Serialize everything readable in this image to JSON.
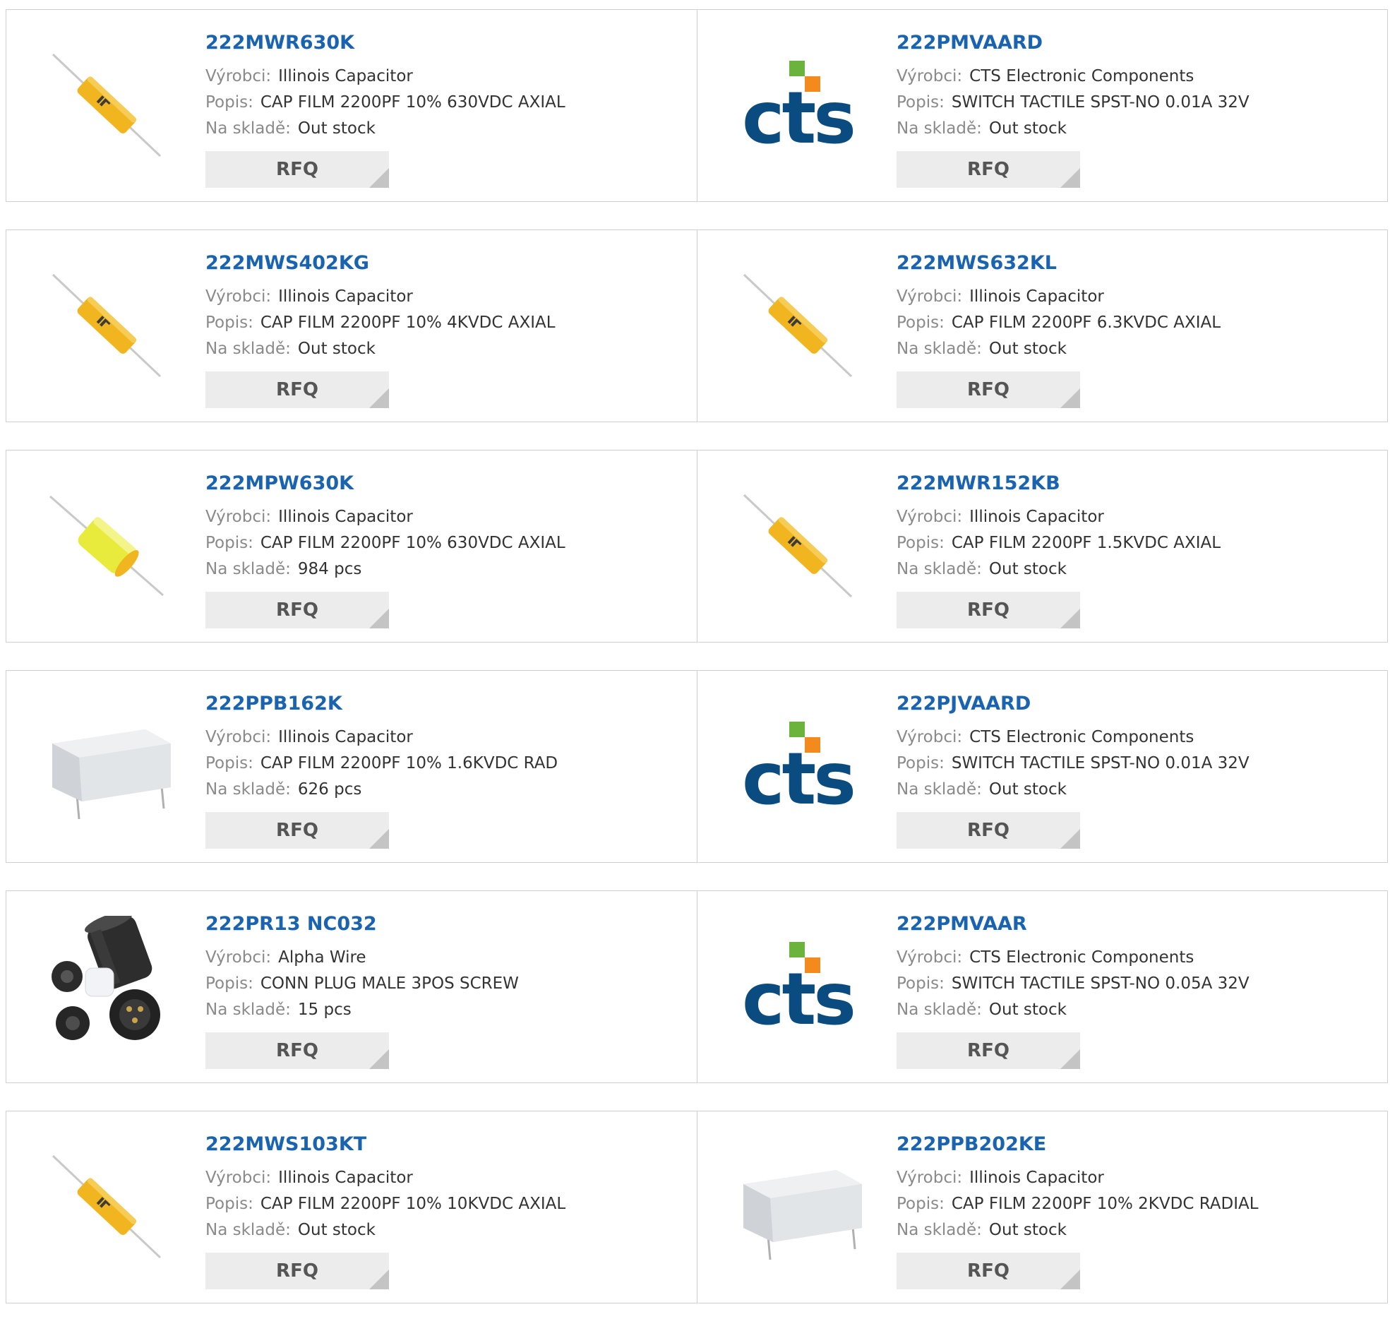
{
  "labels": {
    "manufacturer": "Výrobci:",
    "description": "Popis:",
    "stock": "Na skladě:",
    "rfq": "RFQ"
  },
  "colors": {
    "link": "#1a63b0",
    "label": "#8a8a8a",
    "value": "#333333",
    "rfq_bg": "#ececec",
    "border": "#cfcfcf"
  },
  "products": [
    {
      "part": "222MWR630K",
      "manufacturer": "Illinois Capacitor",
      "description": "CAP FILM 2200PF 10% 630VDC AXIAL",
      "stock": "Out stock",
      "image": "axial-capacitor-orange"
    },
    {
      "part": "222PMVAARD",
      "manufacturer": "CTS Electronic Components",
      "description": "SWITCH TACTILE SPST-NO 0.01A 32V",
      "stock": "Out stock",
      "image": "cts-logo"
    },
    {
      "part": "222MWS402KG",
      "manufacturer": "Illinois Capacitor",
      "description": "CAP FILM 2200PF 10% 4KVDC AXIAL",
      "stock": "Out stock",
      "image": "axial-capacitor-orange"
    },
    {
      "part": "222MWS632KL",
      "manufacturer": "Illinois Capacitor",
      "description": "CAP FILM 2200PF 6.3KVDC AXIAL",
      "stock": "Out stock",
      "image": "axial-capacitor-orange"
    },
    {
      "part": "222MPW630K",
      "manufacturer": "Illinois Capacitor",
      "description": "CAP FILM 2200PF 10% 630VDC AXIAL",
      "stock": "984 pcs",
      "image": "axial-capacitor-yellow"
    },
    {
      "part": "222MWR152KB",
      "manufacturer": "Illinois Capacitor",
      "description": "CAP FILM 2200PF 1.5KVDC AXIAL",
      "stock": "Out stock",
      "image": "axial-capacitor-orange"
    },
    {
      "part": "222PPB162K",
      "manufacturer": "Illinois Capacitor",
      "description": "CAP FILM 2200PF 10% 1.6KVDC RAD",
      "stock": "626 pcs",
      "image": "box-capacitor"
    },
    {
      "part": "222PJVAARD",
      "manufacturer": "CTS Electronic Components",
      "description": "SWITCH TACTILE SPST-NO 0.01A 32V",
      "stock": "Out stock",
      "image": "cts-logo"
    },
    {
      "part": "222PR13 NC032",
      "manufacturer": "Alpha Wire",
      "description": "CONN PLUG MALE 3POS SCREW",
      "stock": "15 pcs",
      "image": "connector-plug"
    },
    {
      "part": "222PMVAAR",
      "manufacturer": "CTS Electronic Components",
      "description": "SWITCH TACTILE SPST-NO 0.05A 32V",
      "stock": "Out stock",
      "image": "cts-logo"
    },
    {
      "part": "222MWS103KT",
      "manufacturer": "Illinois Capacitor",
      "description": "CAP FILM 2200PF 10% 10KVDC AXIAL",
      "stock": "Out stock",
      "image": "axial-capacitor-orange"
    },
    {
      "part": "222PPB202KE",
      "manufacturer": "Illinois Capacitor",
      "description": "CAP FILM 2200PF 10% 2KVDC RADIAL",
      "stock": "Out stock",
      "image": "box-capacitor"
    }
  ]
}
